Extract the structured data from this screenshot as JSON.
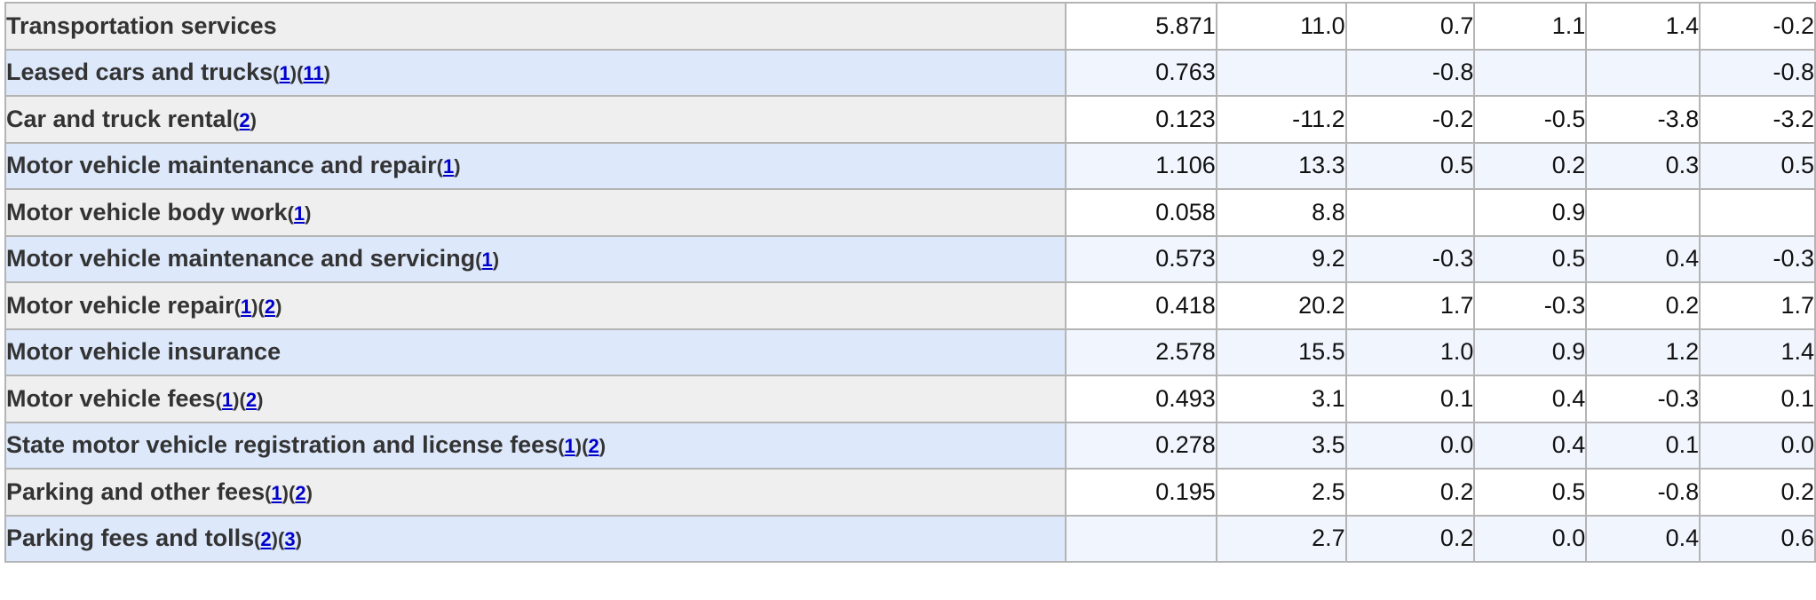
{
  "rows": [
    {
      "label": "Transportation services",
      "level": 1,
      "footnotes": [],
      "values": [
        "5.871",
        "11.0",
        "0.7",
        "1.1",
        "1.4",
        "-0.2"
      ]
    },
    {
      "label": "Leased cars and trucks",
      "level": 2,
      "footnotes": [
        "1",
        "11"
      ],
      "values": [
        "0.763",
        "",
        "-0.8",
        "",
        "",
        "-0.8"
      ]
    },
    {
      "label": "Car and truck rental",
      "level": 2,
      "footnotes": [
        "2"
      ],
      "values": [
        "0.123",
        "-11.2",
        "-0.2",
        "-0.5",
        "-3.8",
        "-3.2"
      ]
    },
    {
      "label": "Motor vehicle maintenance and repair",
      "level": 2,
      "footnotes": [
        "1"
      ],
      "values": [
        "1.106",
        "13.3",
        "0.5",
        "0.2",
        "0.3",
        "0.5"
      ]
    },
    {
      "label": "Motor vehicle body work",
      "level": 3,
      "footnotes": [
        "1"
      ],
      "values": [
        "0.058",
        "8.8",
        "",
        "0.9",
        "",
        ""
      ]
    },
    {
      "label": "Motor vehicle maintenance and servicing",
      "level": 3,
      "footnotes": [
        "1"
      ],
      "values": [
        "0.573",
        "9.2",
        "-0.3",
        "0.5",
        "0.4",
        "-0.3"
      ]
    },
    {
      "label": "Motor vehicle repair",
      "level": 3,
      "footnotes": [
        "1",
        "2"
      ],
      "values": [
        "0.418",
        "20.2",
        "1.7",
        "-0.3",
        "0.2",
        "1.7"
      ]
    },
    {
      "label": "Motor vehicle insurance",
      "level": 2,
      "footnotes": [],
      "values": [
        "2.578",
        "15.5",
        "1.0",
        "0.9",
        "1.2",
        "1.4"
      ]
    },
    {
      "label": "Motor vehicle fees",
      "level": 2,
      "footnotes": [
        "1",
        "2"
      ],
      "values": [
        "0.493",
        "3.1",
        "0.1",
        "0.4",
        "-0.3",
        "0.1"
      ]
    },
    {
      "label": "State motor vehicle registration and license fees",
      "level": 3,
      "footnotes": [
        "1",
        "2"
      ],
      "values": [
        "0.278",
        "3.5",
        "0.0",
        "0.4",
        "0.1",
        "0.0"
      ]
    },
    {
      "label": "Parking and other fees",
      "level": 3,
      "footnotes": [
        "1",
        "2"
      ],
      "values": [
        "0.195",
        "2.5",
        "0.2",
        "0.5",
        "-0.8",
        "0.2"
      ]
    },
    {
      "label": "Parking fees and tolls",
      "level": 4,
      "footnotes": [
        "2",
        "3"
      ],
      "values": [
        "",
        "2.7",
        "0.2",
        "0.0",
        "0.4",
        "0.6"
      ]
    }
  ]
}
